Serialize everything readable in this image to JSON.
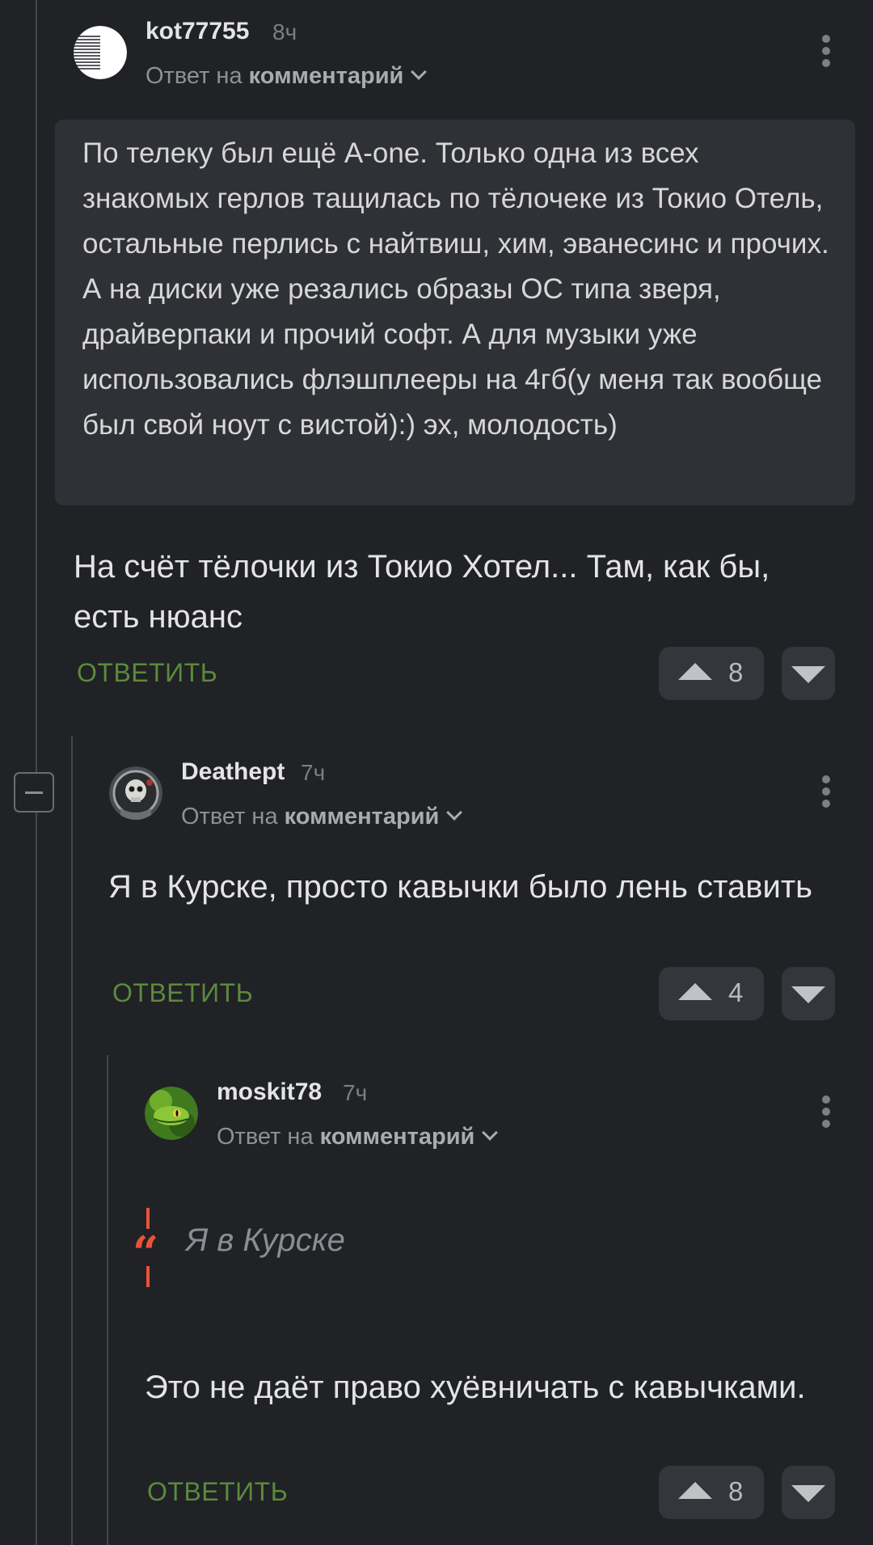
{
  "comments": [
    {
      "username": "kot77755",
      "time": "8ч",
      "reply_prefix": "Ответ на",
      "reply_target": "комментарий",
      "quoted_parent": "По телеку был ещё A-one. Только одна из всех знакомых герлов тащилась по тёлочеке из Токио Отель, остальные перлись с найтвиш, хим, эванесинс и прочих. А на диски уже резались образы ОС типа зверя, драйверпаки и прочий софт. А для музыки уже использовались флэшплееры на 4гб(у меня так вообще был свой ноут с вистой):) эх, молодость)",
      "text": "На счёт тёлочки из Токио Хотел... Там, как бы, есть нюанс",
      "reply_label": "ОТВЕТИТЬ",
      "votes": "8"
    },
    {
      "username": "Deathept",
      "time": "7ч",
      "reply_prefix": "Ответ на",
      "reply_target": "комментарий",
      "text": "Я в Курске, просто кавычки было лень ставить",
      "reply_label": "ОТВЕТИТЬ",
      "votes": "4"
    },
    {
      "username": "moskit78",
      "time": "7ч",
      "reply_prefix": "Ответ на",
      "reply_target": "комментарий",
      "quote": "Я в Курске",
      "text": "Это не даёт право хуёвничать с кавычками.",
      "reply_label": "ОТВЕТИТЬ",
      "votes": "8"
    }
  ],
  "colors": {
    "background": "#202226",
    "reply_link": "#5b8a3c",
    "quote_accent": "#e8533a"
  }
}
